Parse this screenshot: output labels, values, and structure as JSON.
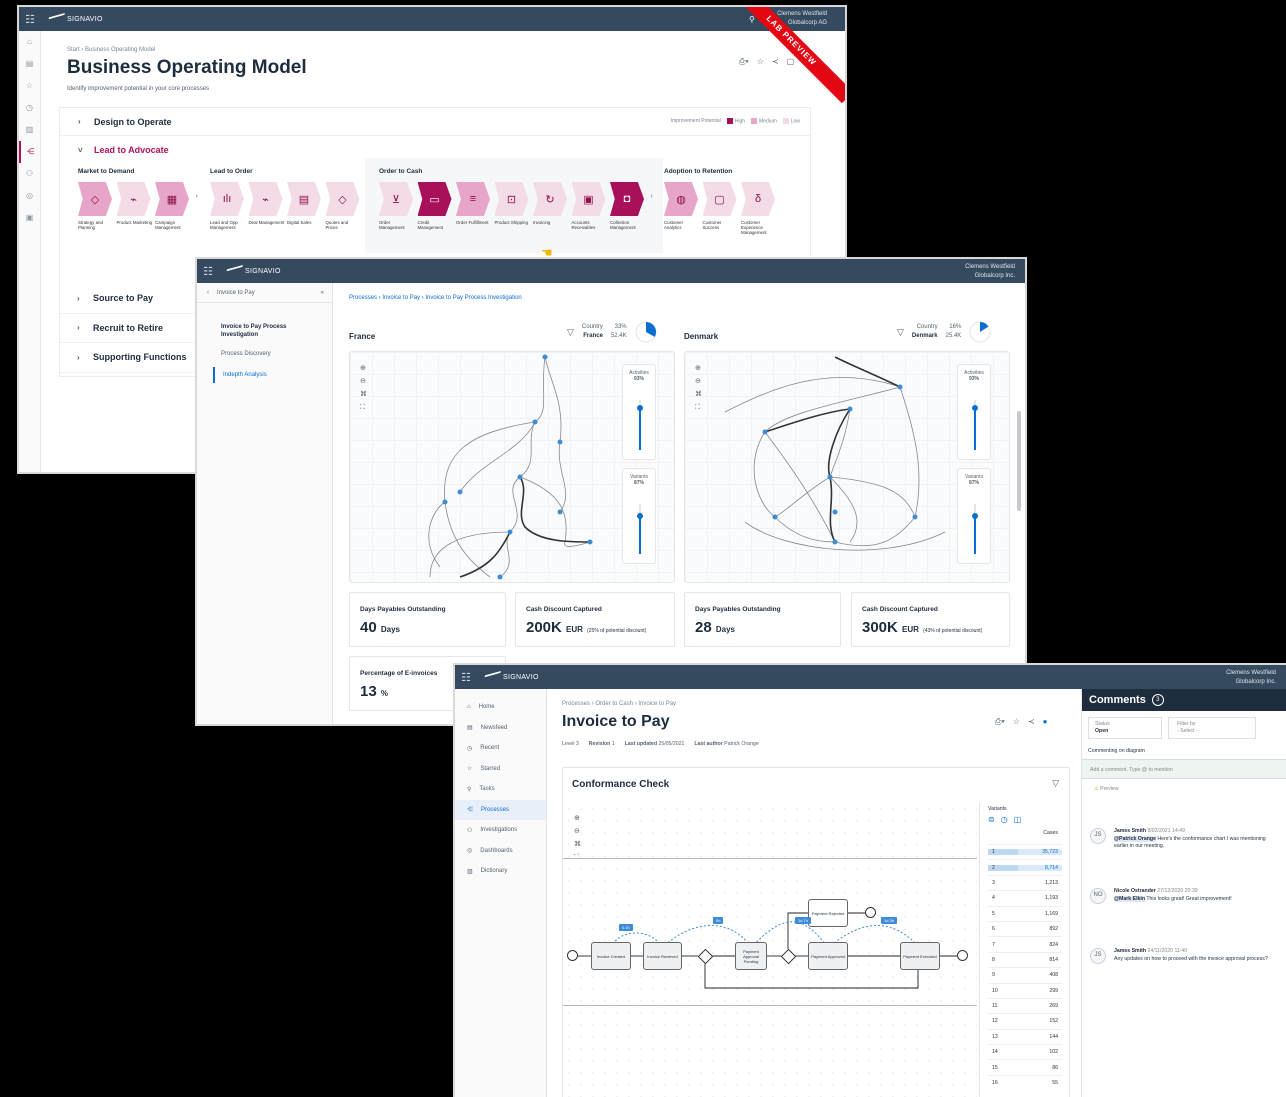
{
  "window1": {
    "brand": "SIGNAVIO",
    "user_name": "Clemens Westfield",
    "user_org": "Globalcorp AG",
    "ribbon": "LAB PREVIEW",
    "breadcrumb": "Start › Business Operating Model",
    "title": "Business Operating Model",
    "subtitle": "Identify improvement potential in your core processes",
    "legend": {
      "label": "Improvement Potential",
      "high": "High",
      "medium": "Medium",
      "low": "Low",
      "high_color": "#a8115a",
      "medium_color": "#e7a5c9",
      "low_color": "#f3dbe7"
    },
    "sections": [
      {
        "label": "Design to Operate",
        "expanded": false
      },
      {
        "label": "Lead to Advocate",
        "expanded": true
      },
      {
        "label": "Source to Pay",
        "expanded": false
      },
      {
        "label": "Recruit to Retire",
        "expanded": false
      },
      {
        "label": "Supporting Functions",
        "expanded": false
      }
    ],
    "groups": [
      {
        "title": "Market to Demand",
        "caps": [
          {
            "label": "Strategy and Planning",
            "level": "m",
            "icon": "◇"
          },
          {
            "label": "Product Marketing",
            "level": "l",
            "icon": "⌁"
          },
          {
            "label": "Campaign Management",
            "level": "m",
            "icon": "▦"
          }
        ]
      },
      {
        "title": "Lead to Order",
        "caps": [
          {
            "label": "Lead and Opp Management",
            "level": "l",
            "icon": "ılı"
          },
          {
            "label": "Deal Management",
            "level": "l",
            "icon": "⌁"
          },
          {
            "label": "Digital Sales",
            "level": "l",
            "icon": "▤"
          },
          {
            "label": "Quotes and Prices",
            "level": "l",
            "icon": "◇"
          }
        ]
      },
      {
        "title": "Order to Cash",
        "caps": [
          {
            "label": "Order Management",
            "level": "l",
            "icon": "⊻"
          },
          {
            "label": "Credit Management",
            "level": "h",
            "icon": "▭"
          },
          {
            "label": "Order Fulfillment",
            "level": "m",
            "icon": "≡"
          },
          {
            "label": "Product Shipping",
            "level": "l",
            "icon": "⊡"
          },
          {
            "label": "Invoicing",
            "level": "l",
            "icon": "↻"
          },
          {
            "label": "Accounts Receivables",
            "level": "l",
            "icon": "▣"
          },
          {
            "label": "Collection Management",
            "level": "h",
            "icon": "◘"
          }
        ]
      },
      {
        "title": "Adoption to Retention",
        "caps": [
          {
            "label": "Customer Analytics",
            "level": "m",
            "icon": "◍"
          },
          {
            "label": "Customer Success",
            "level": "l",
            "icon": "▢"
          },
          {
            "label": "Customer Experience Management",
            "level": "l",
            "icon": "δ"
          }
        ]
      }
    ]
  },
  "window2": {
    "brand": "SIGNAVIO",
    "user_name": "Clemens Westfield",
    "user_org": "Globalcorp Inc.",
    "back_label": "Invoice to Pay",
    "nav": [
      {
        "label": "Invoice to Pay Process Investigation",
        "active": false,
        "bold": true
      },
      {
        "label": "Process Discovery",
        "active": false,
        "bold": false
      },
      {
        "label": "Indepth Analysis",
        "active": true,
        "bold": false
      }
    ],
    "breadcrumb": "Processes  ›  Invoice to Pay  ›  Invoice to Pay Process Investigation",
    "left": {
      "title": "France",
      "filter_label": "Country",
      "filter_value": "France",
      "pct": "33%",
      "cases": "52.4K",
      "pct_fraction": 0.33
    },
    "right": {
      "title": "Denmark",
      "filter_label": "Country",
      "filter_value": "Denmark",
      "pct": "16%",
      "cases": "25.4K",
      "pct_fraction": 0.16
    },
    "activities_label": "Activities",
    "activities_left": "93%",
    "activities_right": "93%",
    "variants_label": "Variants",
    "variants_left": "87%",
    "variants_right": "87%",
    "kpis": [
      {
        "title": "Days Payables Outstanding",
        "value": "40",
        "unit": "Days",
        "note": ""
      },
      {
        "title": "Cash Discount Captured",
        "value": "200K",
        "unit": "EUR",
        "note": "(25% of potential discount)"
      },
      {
        "title": "Days Payables Outstanding",
        "value": "28",
        "unit": "Days",
        "note": ""
      },
      {
        "title": "Cash Discount Captured",
        "value": "300K",
        "unit": "EUR",
        "note": "(43% of potential discount)"
      },
      {
        "title": "Percentage of E-invoices",
        "value": "13",
        "unit": "%",
        "note": ""
      }
    ]
  },
  "window3": {
    "brand": "SIGNAVIO",
    "user_name": "Clemens Westfield",
    "user_org": "Globalcorp Inc.",
    "nav": [
      {
        "label": "Home",
        "icon": "⌂",
        "active": false
      },
      {
        "label": "Newsfeed",
        "icon": "▤",
        "active": false
      },
      {
        "label": "Recent",
        "icon": "◷",
        "active": false
      },
      {
        "label": "Starred",
        "icon": "☆",
        "active": false
      },
      {
        "label": "Tasks",
        "icon": "⚲",
        "active": false
      },
      {
        "label": "Processes",
        "icon": "⋲",
        "active": true
      },
      {
        "label": "Investigations",
        "icon": "⚇",
        "active": false
      },
      {
        "label": "Dashboards",
        "icon": "◎",
        "active": false
      },
      {
        "label": "Dictionary",
        "icon": "▥",
        "active": false
      }
    ],
    "breadcrumb": "Processes  ›  Order to Cash  ›  Invoice to Pay",
    "title": "Invoice to Pay",
    "meta": {
      "level": "Level 3",
      "revision_label": "Revision",
      "revision": "1",
      "updated_label": "Last updated",
      "updated": "25/05/2021",
      "author_label": "Last author",
      "author": "Patrick Orange"
    },
    "card_title": "Conformance Check",
    "variants_label": "Variants",
    "cases_label": "Cases",
    "variants": [
      {
        "n": "1",
        "cases": "35,723",
        "selected": true
      },
      {
        "n": "2",
        "cases": "8,714",
        "selected": true
      },
      {
        "n": "3",
        "cases": "1,213",
        "selected": false
      },
      {
        "n": "4",
        "cases": "1,193",
        "selected": false
      },
      {
        "n": "5",
        "cases": "1,169",
        "selected": false
      },
      {
        "n": "6",
        "cases": "892",
        "selected": false
      },
      {
        "n": "7",
        "cases": "824",
        "selected": false
      },
      {
        "n": "8",
        "cases": "814",
        "selected": false
      },
      {
        "n": "9",
        "cases": "408",
        "selected": false
      },
      {
        "n": "10",
        "cases": "299",
        "selected": false
      },
      {
        "n": "11",
        "cases": "269",
        "selected": false
      },
      {
        "n": "12",
        "cases": "152",
        "selected": false
      },
      {
        "n": "13",
        "cases": "144",
        "selected": false
      },
      {
        "n": "14",
        "cases": "102",
        "selected": false
      },
      {
        "n": "15",
        "cases": "86",
        "selected": false
      },
      {
        "n": "16",
        "cases": "55",
        "selected": false
      }
    ],
    "activities": [
      "Invoice Created",
      "Invoice Received",
      "Payment Approval Pending",
      "Payment Approved",
      "Payment Executed",
      "Payment Rejected"
    ],
    "tags": [
      "0.1h",
      "0h",
      "1d 7h",
      "1d 3h"
    ],
    "comments": {
      "title": "Comments",
      "count": "3",
      "status_label": "Status",
      "status_value": "Open",
      "filter_label": "Filter by",
      "filter_value": "- Select -",
      "section_label": "Commenting on diagram",
      "input_placeholder": "Add a comment. Type @ to mention",
      "preview_label": "Preview",
      "items": [
        {
          "initials": "JS",
          "author": "James Smith",
          "date": "8/02/2021 14:49",
          "mention": "@Patrick Orange",
          "text": " Here's the conformance chart I was mentioning earlier in our meeting."
        },
        {
          "initials": "NO",
          "author": "Nicole Ostrander",
          "date": "27/12/2020 20:39",
          "mention": "@Mark Elkin",
          "text": " This looks great! Great improvement!"
        },
        {
          "initials": "JS",
          "author": "James Smith",
          "date": "24/11/2020 11:40",
          "mention": "",
          "text": "Any updates on how to proceed with the invoice approval process?"
        }
      ]
    }
  }
}
